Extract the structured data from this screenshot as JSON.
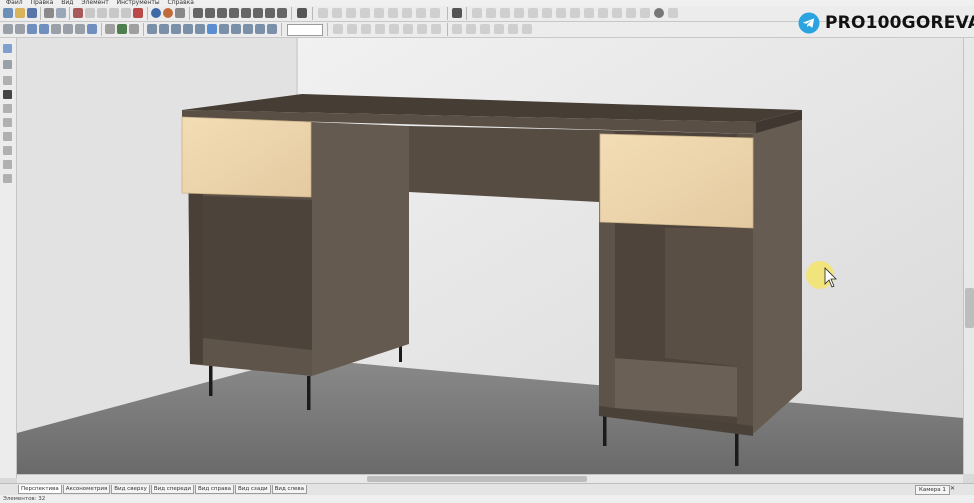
{
  "menu": [
    "Файл",
    "Правка",
    "Вид",
    "Элемент",
    "Инструменты",
    "Справка"
  ],
  "brand": {
    "text": "PRO100GOREVA",
    "icon": "telegram-icon",
    "color": "#2aa3e0"
  },
  "views": {
    "tabs": [
      "Перспектива",
      "Аксонометрия",
      "Вид сверху",
      "Вид спереди",
      "Вид справа",
      "Вид сзади",
      "Вид слева"
    ],
    "active": 0,
    "camera": "Камера 1",
    "close": "✕"
  },
  "status": "Элементов: 32",
  "colors": {
    "wood_dark": "#5a4e43",
    "facade_light": "#ecd5ae",
    "wall": "#e6e6e6",
    "floor": "#777777",
    "cursor_highlight": "#f4e46a"
  }
}
